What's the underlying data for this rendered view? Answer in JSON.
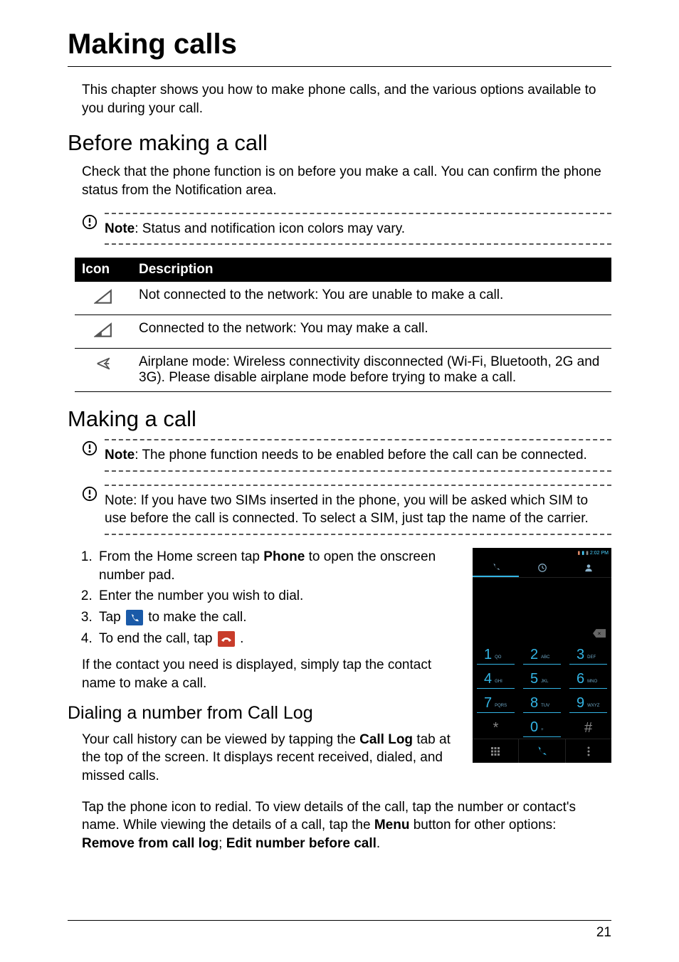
{
  "chapter_title": "Making calls",
  "intro": "This chapter shows you how to make phone calls, and the various options available to you during your call.",
  "section_before": {
    "title": "Before making a call",
    "body": "Check that the phone function is on before you make a call. You can confirm the phone status from the Notification area.",
    "note_label": "Note",
    "note_text": ": Status and notification icon colors may vary."
  },
  "icon_table": {
    "headers": [
      "Icon",
      "Description"
    ],
    "rows": [
      {
        "icon": "signal-empty",
        "desc": "Not connected to the network: You are unable to make a call."
      },
      {
        "icon": "signal-partial",
        "desc": "Connected to the network: You may make a call."
      },
      {
        "icon": "airplane",
        "desc": "Airplane mode: Wireless connectivity disconnected (Wi-Fi, Bluetooth, 2G and 3G). Please disable airplane mode before trying to make a call."
      }
    ]
  },
  "section_making": {
    "title": "Making a call",
    "note1_label": "Note",
    "note1_text": ": The phone function needs to be enabled before the call can be connected.",
    "note2_text": "Note: If you have two SIMs inserted in the phone, you will be asked which SIM to use before the call is connected. To select a SIM, just tap the name of the carrier.",
    "steps": [
      {
        "pre": "From the Home screen tap ",
        "bold": "Phone",
        "post": " to open the onscreen number pad."
      },
      {
        "pre": "Enter the number you wish to dial."
      },
      {
        "pre": "Tap ",
        "icon": "dial-icon",
        "post": " to make the call."
      },
      {
        "pre": "To end the call, tap ",
        "icon": "endcall-icon",
        "post": "."
      }
    ],
    "after_list": "If the contact you need is displayed, simply tap the contact name to make a call."
  },
  "section_dialing": {
    "title": "Dialing a number from Call Log",
    "body1_pre": "Your call history can be viewed by tapping the ",
    "body1_bold": "Call Log",
    "body1_post": " tab at the top of the screen. It displays recent received, dialed, and missed calls.",
    "body2_pre": "Tap the phone icon to redial. To view details of the call, tap the number or contact's name. While viewing the details of a call, tap the ",
    "body2_bold1": "Menu",
    "body2_mid": " button for other options: ",
    "body2_bold2": "Remove from call log",
    "body2_sep": "; ",
    "body2_bold3": "Edit number before call",
    "body2_end": "."
  },
  "keypad": {
    "keys": [
      {
        "d": "1",
        "l": "QO"
      },
      {
        "d": "2",
        "l": "ABC"
      },
      {
        "d": "3",
        "l": "DEF"
      },
      {
        "d": "4",
        "l": "GHI"
      },
      {
        "d": "5",
        "l": "JKL"
      },
      {
        "d": "6",
        "l": "MNO"
      },
      {
        "d": "7",
        "l": "PQRS"
      },
      {
        "d": "8",
        "l": "TUV"
      },
      {
        "d": "9",
        "l": "WXYZ"
      },
      {
        "d": "*",
        "l": ""
      },
      {
        "d": "0",
        "l": "+"
      },
      {
        "d": "#",
        "l": ""
      }
    ],
    "time": "2:02 PM"
  },
  "page_number": "21"
}
